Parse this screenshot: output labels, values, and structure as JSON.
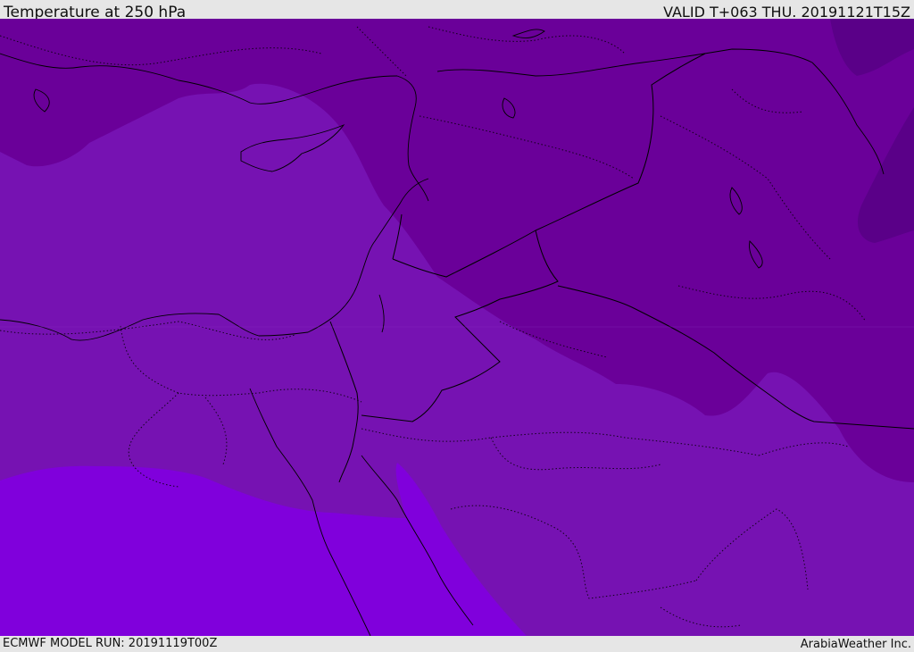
{
  "header": {
    "title": "Temperature at 250 hPa",
    "valid_time": "VALID T+063 THU. 20191121T15Z"
  },
  "footer": {
    "model_run": "ECMWF MODEL RUN: 20191119T00Z",
    "credit": "ArabiaWeather Inc."
  },
  "map": {
    "field": "temperature",
    "level": "250 hPa",
    "colors": {
      "band_coldest": "#5a0088",
      "band_cold": "#6a0099",
      "band_mid": "#7612b2",
      "band_warm": "#8000dc",
      "boundary": "#000000"
    }
  }
}
